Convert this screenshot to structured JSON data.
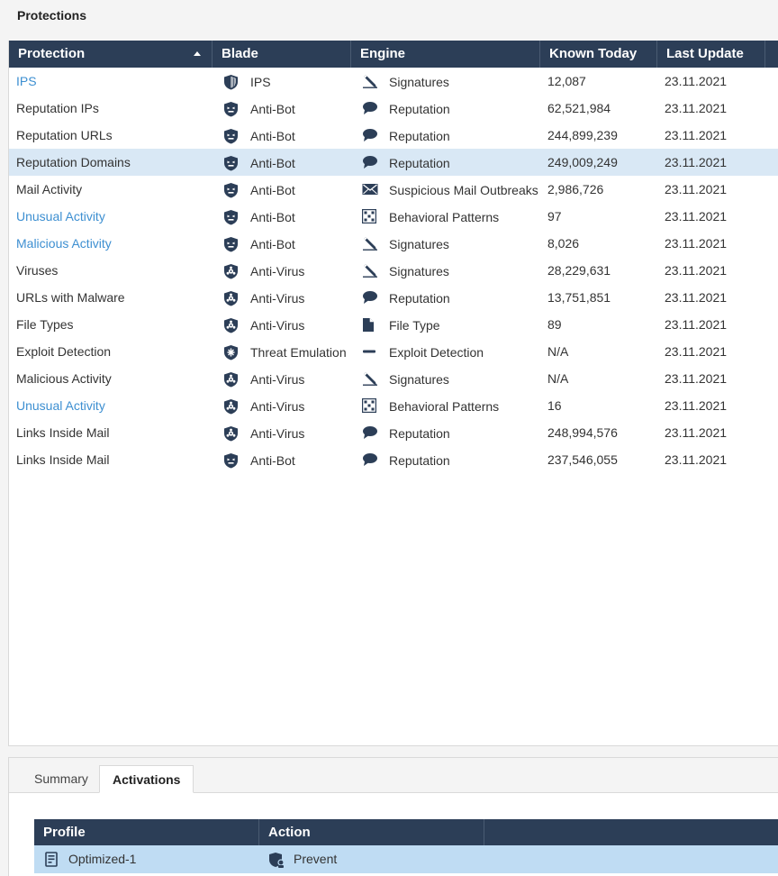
{
  "page_title": "Protections",
  "columns": {
    "protection": "Protection",
    "blade": "Blade",
    "engine": "Engine",
    "known_today": "Known Today",
    "last_update": "Last Update"
  },
  "rows": [
    {
      "protection": "IPS",
      "link": true,
      "blade": "IPS",
      "blade_icon": "ips-icon",
      "engine": "Signatures",
      "engine_icon": "pencil-icon",
      "known": "12,087",
      "date": "23.11.2021"
    },
    {
      "protection": "Reputation IPs",
      "link": false,
      "blade": "Anti-Bot",
      "blade_icon": "anti-bot-icon",
      "engine": "Reputation",
      "engine_icon": "speech-bubble-icon",
      "known": "62,521,984",
      "date": "23.11.2021"
    },
    {
      "protection": "Reputation URLs",
      "link": false,
      "blade": "Anti-Bot",
      "blade_icon": "anti-bot-icon",
      "engine": "Reputation",
      "engine_icon": "speech-bubble-icon",
      "known": "244,899,239",
      "date": "23.11.2021"
    },
    {
      "protection": "Reputation Domains",
      "link": false,
      "selected": true,
      "blade": "Anti-Bot",
      "blade_icon": "anti-bot-icon",
      "engine": "Reputation",
      "engine_icon": "speech-bubble-icon",
      "known": "249,009,249",
      "date": "23.11.2021"
    },
    {
      "protection": "Mail Activity",
      "link": false,
      "blade": "Anti-Bot",
      "blade_icon": "anti-bot-icon",
      "engine": "Suspicious Mail Outbreaks",
      "engine_icon": "envelope-icon",
      "known": "2,986,726",
      "date": "23.11.2021"
    },
    {
      "protection": "Unusual Activity",
      "link": true,
      "blade": "Anti-Bot",
      "blade_icon": "anti-bot-icon",
      "engine": "Behavioral Patterns",
      "engine_icon": "pattern-icon",
      "known": "97",
      "date": "23.11.2021"
    },
    {
      "protection": "Malicious Activity",
      "link": true,
      "blade": "Anti-Bot",
      "blade_icon": "anti-bot-icon",
      "engine": "Signatures",
      "engine_icon": "pencil-icon",
      "known": "8,026",
      "date": "23.11.2021"
    },
    {
      "protection": "Viruses",
      "link": false,
      "blade": "Anti-Virus",
      "blade_icon": "anti-virus-icon",
      "engine": "Signatures",
      "engine_icon": "pencil-icon",
      "known": "28,229,631",
      "date": "23.11.2021"
    },
    {
      "protection": "URLs with Malware",
      "link": false,
      "blade": "Anti-Virus",
      "blade_icon": "anti-virus-icon",
      "engine": "Reputation",
      "engine_icon": "speech-bubble-icon",
      "known": "13,751,851",
      "date": "23.11.2021"
    },
    {
      "protection": "File Types",
      "link": false,
      "blade": "Anti-Virus",
      "blade_icon": "anti-virus-icon",
      "engine": "File Type",
      "engine_icon": "file-icon",
      "known": "89",
      "date": "23.11.2021"
    },
    {
      "protection": "Exploit Detection",
      "link": false,
      "blade": "Threat Emulation",
      "blade_icon": "threat-emulation-icon",
      "engine": "Exploit Detection",
      "engine_icon": "dash-icon",
      "known": "N/A",
      "date": "23.11.2021"
    },
    {
      "protection": "Malicious Activity",
      "link": false,
      "blade": "Anti-Virus",
      "blade_icon": "anti-virus-icon",
      "engine": "Signatures",
      "engine_icon": "pencil-icon",
      "known": "N/A",
      "date": "23.11.2021"
    },
    {
      "protection": "Unusual Activity",
      "link": true,
      "blade": "Anti-Virus",
      "blade_icon": "anti-virus-icon",
      "engine": "Behavioral Patterns",
      "engine_icon": "pattern-icon",
      "known": "16",
      "date": "23.11.2021"
    },
    {
      "protection": "Links Inside Mail",
      "link": false,
      "blade": "Anti-Virus",
      "blade_icon": "anti-virus-icon",
      "engine": "Reputation",
      "engine_icon": "speech-bubble-icon",
      "known": "248,994,576",
      "date": "23.11.2021"
    },
    {
      "protection": "Links Inside Mail",
      "link": false,
      "blade": "Anti-Bot",
      "blade_icon": "anti-bot-icon",
      "engine": "Reputation",
      "engine_icon": "speech-bubble-icon",
      "known": "237,546,055",
      "date": "23.11.2021"
    }
  ],
  "colors": {
    "header": "#2c3e57",
    "link": "#3d8fd1",
    "selected_row": "#d9e8f5",
    "activation_row": "#bfdcf3",
    "icon": "#2c3e57"
  },
  "tabs": [
    {
      "label": "Summary",
      "active": false
    },
    {
      "label": "Activations",
      "active": true
    }
  ],
  "activations": {
    "columns": {
      "profile": "Profile",
      "action": "Action"
    },
    "rows": [
      {
        "profile": "Optimized-1",
        "profile_icon": "profile-icon",
        "action": "Prevent",
        "action_icon": "prevent-shield-icon"
      }
    ]
  }
}
